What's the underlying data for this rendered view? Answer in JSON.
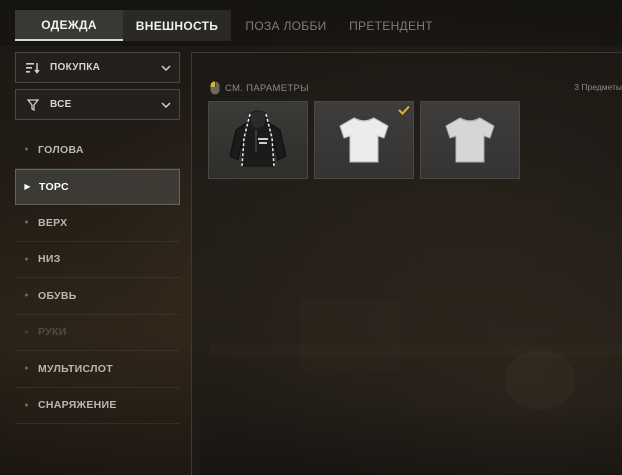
{
  "tabs": [
    {
      "label": "ОДЕЖДА",
      "active": true
    },
    {
      "label": "ВНЕШНОСТЬ",
      "active": false
    },
    {
      "label": "ПОЗА ЛОББИ",
      "active": false
    },
    {
      "label": "ПРЕТЕНДЕНТ",
      "active": false
    }
  ],
  "sidebar": {
    "sort": {
      "label": "ПОКУПКА",
      "icon": "sort-icon"
    },
    "filter": {
      "label": "ВСЕ",
      "icon": "filter-icon"
    },
    "categories": [
      {
        "label": "ГОЛОВА",
        "state": "normal"
      },
      {
        "label": "ТОРС",
        "state": "active"
      },
      {
        "label": "ВЕРХ",
        "state": "normal"
      },
      {
        "label": "НИЗ",
        "state": "normal"
      },
      {
        "label": "ОБУВЬ",
        "state": "normal"
      },
      {
        "label": "РУКИ",
        "state": "disabled"
      },
      {
        "label": "МУЛЬТИСЛОТ",
        "state": "normal"
      },
      {
        "label": "СНАРЯЖЕНИЕ",
        "state": "normal"
      }
    ]
  },
  "main": {
    "view_params_label": "СМ. ПАРАМЕТРЫ",
    "item_count": "3 Предметы",
    "items": [
      {
        "name": "black-hoodie",
        "equipped": false
      },
      {
        "name": "white-tshirt",
        "equipped": true
      },
      {
        "name": "grey-tshirt",
        "equipped": false
      }
    ]
  },
  "colors": {
    "accent_check": "#d4b638",
    "active_tab_bg": "#3a3835"
  }
}
